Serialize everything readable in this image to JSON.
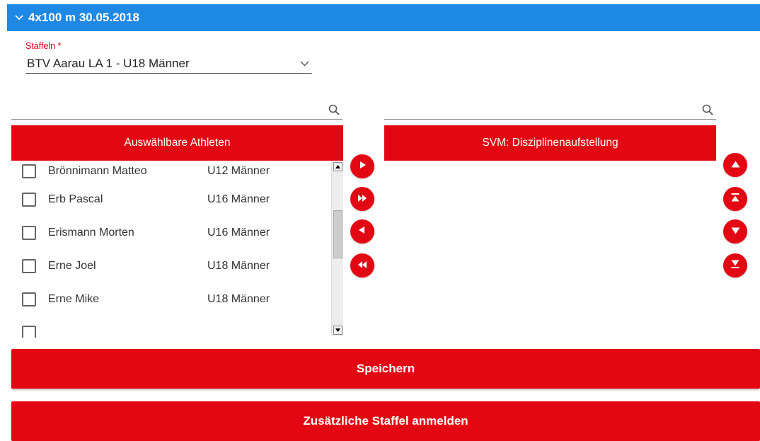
{
  "panel": {
    "title": "4x100 m 30.05.2018"
  },
  "staffeln": {
    "label": "Staffeln *",
    "selected": "BTV Aarau LA 1 - U18 Männer"
  },
  "left_list": {
    "header": "Auswählbare Athleten",
    "rows": [
      {
        "name": "Brönnimann Matteo",
        "category": "U12 Männer"
      },
      {
        "name": "Erb Pascal",
        "category": "U16 Männer"
      },
      {
        "name": "Erismann Morten",
        "category": "U16 Männer"
      },
      {
        "name": "Erne Joel",
        "category": "U18 Männer"
      },
      {
        "name": "Erne Mike",
        "category": "U18 Männer"
      }
    ]
  },
  "right_list": {
    "header": "SVM: Disziplinenaufstellung"
  },
  "actions": {
    "save": "Speichern",
    "add_relay": "Zusätzliche Staffel anmelden"
  },
  "icons": {
    "panel_toggle": "chevron-down-icon",
    "dropdown": "chevron-down-icon",
    "search": "search-icon",
    "move_right": "play-icon",
    "move_all_right": "fast-forward-icon",
    "move_left": "play-left-icon",
    "move_all_left": "rewind-icon",
    "move_up": "arrow-up-icon",
    "move_top": "arrow-top-icon",
    "move_down": "arrow-down-icon",
    "move_bottom": "arrow-bottom-icon"
  },
  "colors": {
    "header_blue": "#1e88e5",
    "accent_red": "#e30613",
    "label_red": "#e0001b"
  }
}
